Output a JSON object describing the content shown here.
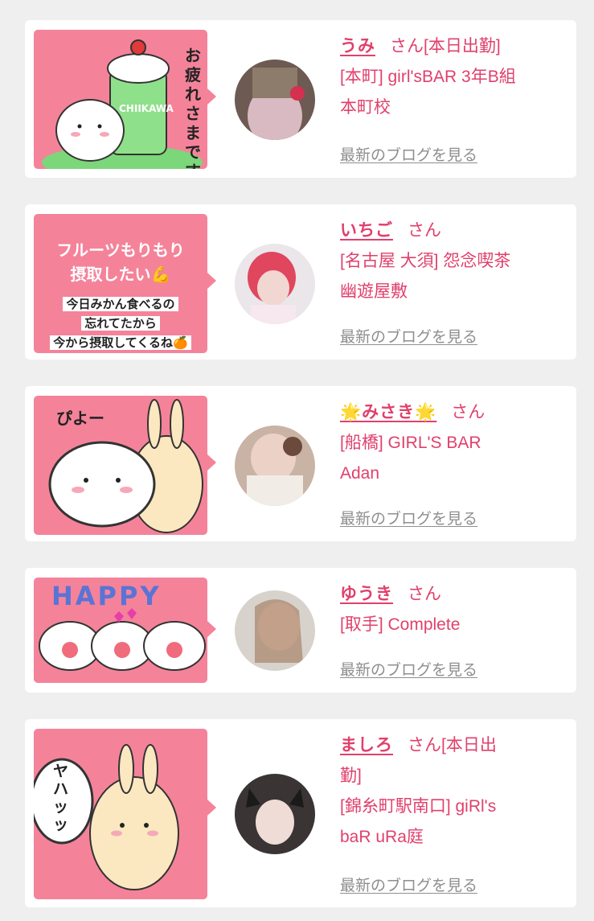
{
  "cards": [
    {
      "name": "うみ",
      "honorific": "さん",
      "status": "[本日出勤]",
      "shop_line1": "[本町] girl'sBAR 3年B組",
      "shop_line2": "本町校",
      "blog_link": "最新のブログを見る",
      "thumb_text": "お疲れさまです",
      "thumb_cup_text": "CHIIKAWA"
    },
    {
      "name": "いちご",
      "honorific": "さん",
      "status": "",
      "shop_line1": "[名古屋 大須] 怨念喫茶",
      "shop_line2": "幽遊屋敷",
      "blog_link": "最新のブログを見る",
      "thumb_line1": "フルーツもりもり",
      "thumb_line2": "摂取したい💪",
      "thumb_line3": "今日みかん食べるの",
      "thumb_line4": "忘れてたから",
      "thumb_line5": "今から摂取してくるね🍊"
    },
    {
      "name": "🌟みさき🌟",
      "honorific": "さん",
      "status": "",
      "shop_line1": "[船橋] GIRL'S BAR",
      "shop_line2": "Adan",
      "blog_link": "最新のブログを見る",
      "thumb_text": "ぴよー"
    },
    {
      "name": "ゆうき",
      "honorific": "さん",
      "status": "",
      "shop_line1": "[取手] Complete",
      "shop_line2": "",
      "blog_link": "最新のブログを見る",
      "thumb_text": "HAPPY"
    },
    {
      "name": "ましろ",
      "honorific": "さん",
      "status": "[本日出",
      "status2": "勤]",
      "shop_line1": "[錦糸町駅南口] giRl's",
      "shop_line2": "baR uRa庭",
      "blog_link": "最新のブログを見る",
      "thumb_text": "ヤハッッ"
    }
  ]
}
